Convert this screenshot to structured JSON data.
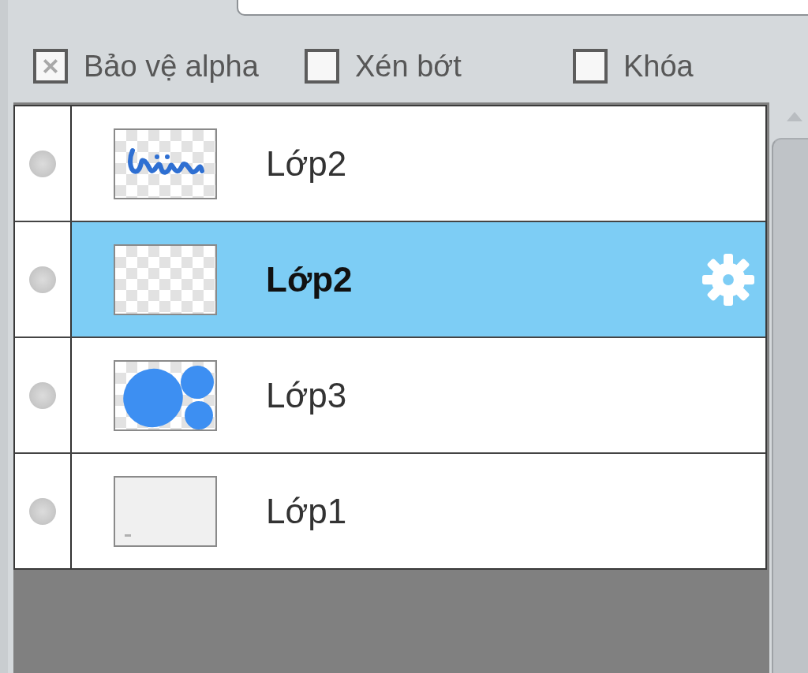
{
  "options": [
    {
      "label": "Bảo vệ alpha",
      "checked": true
    },
    {
      "label": "Xén bớt",
      "checked": false
    },
    {
      "label": "Khóa",
      "checked": false
    }
  ],
  "layers": [
    {
      "name": "Lớp2",
      "kind": "lettering",
      "selected": false
    },
    {
      "name": "Lớp2",
      "kind": "transparent",
      "selected": true
    },
    {
      "name": "Lớp3",
      "kind": "circles",
      "selected": false
    },
    {
      "name": "Lớp1",
      "kind": "blank",
      "selected": false
    }
  ]
}
